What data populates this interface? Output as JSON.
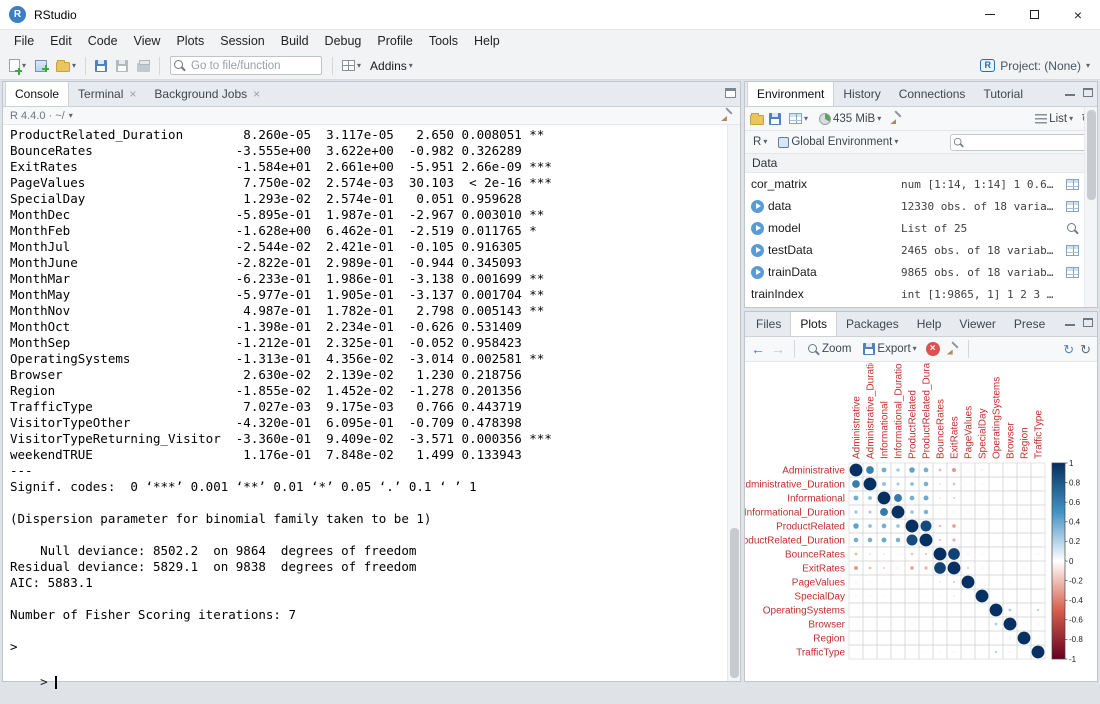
{
  "window": {
    "title": "RStudio",
    "logo_letter": "R"
  },
  "glyphs": {
    "caret": "▾",
    "close": "×",
    "back": "←",
    "forward": "→",
    "refresh": "↻",
    "prompt": "> "
  },
  "menu": {
    "items": [
      "File",
      "Edit",
      "Code",
      "View",
      "Plots",
      "Session",
      "Build",
      "Debug",
      "Profile",
      "Tools",
      "Help"
    ]
  },
  "toolbar": {
    "goto_placeholder": "Go to file/function",
    "addins_label": "Addins",
    "project_label": "Project: (None)",
    "project_icon_letter": "R"
  },
  "console_pane": {
    "tabs": [
      {
        "label": "Console",
        "active": true,
        "closable": false
      },
      {
        "label": "Terminal",
        "active": false,
        "closable": true
      },
      {
        "label": "Background Jobs",
        "active": false,
        "closable": true
      }
    ],
    "header": {
      "r_version": "R 4.4.0 · ~/"
    },
    "lines": [
      "ProductRelated_Duration        8.260e-05  3.117e-05   2.650 0.008051 **",
      "BounceRates                   -3.555e+00  3.622e+00  -0.982 0.326289",
      "ExitRates                     -1.584e+01  2.661e+00  -5.951 2.66e-09 ***",
      "PageValues                     7.750e-02  2.574e-03  30.103  < 2e-16 ***",
      "SpecialDay                     1.293e-02  2.574e-01   0.051 0.959628",
      "MonthDec                      -5.895e-01  1.987e-01  -2.967 0.003010 **",
      "MonthFeb                      -1.628e+00  6.462e-01  -2.519 0.011765 *",
      "MonthJul                      -2.544e-02  2.421e-01  -0.105 0.916305",
      "MonthJune                     -2.822e-01  2.989e-01  -0.944 0.345093",
      "MonthMar                      -6.233e-01  1.986e-01  -3.138 0.001699 **",
      "MonthMay                      -5.977e-01  1.905e-01  -3.137 0.001704 **",
      "MonthNov                       4.987e-01  1.782e-01   2.798 0.005143 **",
      "MonthOct                      -1.398e-01  2.234e-01  -0.626 0.531409",
      "MonthSep                      -1.212e-01  2.325e-01  -0.052 0.958423",
      "OperatingSystems              -1.313e-01  4.356e-02  -3.014 0.002581 **",
      "Browser                        2.630e-02  2.139e-02   1.230 0.218756",
      "Region                        -1.855e-02  1.452e-02  -1.278 0.201356",
      "TrafficType                    7.027e-03  9.175e-03   0.766 0.443719",
      "VisitorTypeOther              -4.320e-01  6.095e-01  -0.709 0.478398",
      "VisitorTypeReturning_Visitor  -3.360e-01  9.409e-02  -3.571 0.000356 ***",
      "weekendTRUE                    1.176e-01  7.848e-02   1.499 0.133943",
      "---",
      "Signif. codes:  0 ‘***’ 0.001 ‘**’ 0.01 ‘*’ 0.05 ‘.’ 0.1 ‘ ’ 1",
      "",
      "(Dispersion parameter for binomial family taken to be 1)",
      "",
      "    Null deviance: 8502.2  on 9864  degrees of freedom",
      "Residual deviance: 5829.1  on 9838  degrees of freedom",
      "AIC: 5883.1",
      "",
      "Number of Fisher Scoring iterations: 7",
      "",
      ">"
    ]
  },
  "environment_pane": {
    "tabs": [
      {
        "label": "Environment",
        "active": true
      },
      {
        "label": "History",
        "active": false
      },
      {
        "label": "Connections",
        "active": false
      },
      {
        "label": "Tutorial",
        "active": false
      }
    ],
    "toolbar": {
      "memory": "435 MiB",
      "view_mode": "List"
    },
    "scope": {
      "language": "R",
      "environment": "Global Environment"
    },
    "section": "Data",
    "objects": [
      {
        "name": "cor_matrix",
        "value": "num [1:14, 1:14] 1 0.6…",
        "expandable": false,
        "action": "grid"
      },
      {
        "name": "data",
        "value": "12330 obs. of 18 varia…",
        "expandable": true,
        "action": "grid"
      },
      {
        "name": "model",
        "value": "List of 25",
        "expandable": true,
        "action": "magnifier"
      },
      {
        "name": "testData",
        "value": "2465 obs. of 18 variab…",
        "expandable": true,
        "action": "grid"
      },
      {
        "name": "trainData",
        "value": "9865 obs. of 18 variab…",
        "expandable": true,
        "action": "grid"
      },
      {
        "name": "trainIndex",
        "value": "int [1:9865, 1] 1 2 3 …",
        "expandable": false,
        "action": "none"
      }
    ]
  },
  "plots_pane": {
    "tabs": [
      {
        "label": "Files",
        "active": false
      },
      {
        "label": "Plots",
        "active": true
      },
      {
        "label": "Packages",
        "active": false
      },
      {
        "label": "Help",
        "active": false
      },
      {
        "label": "Viewer",
        "active": false
      },
      {
        "label": "Prese",
        "active": false
      }
    ],
    "toolbar": {
      "zoom_label": "Zoom",
      "export_label": "Export"
    }
  },
  "chart_data": {
    "type": "heatmap",
    "subtype": "correlation-circles",
    "title": "",
    "variables": [
      "Administrative",
      "Administrative_Duration",
      "Informational",
      "Informational_Duration",
      "ProductRelated",
      "ProductRelated_Duration",
      "BounceRates",
      "ExitRates",
      "PageValues",
      "SpecialDay",
      "OperatingSystems",
      "Browser",
      "Region",
      "TrafficType"
    ],
    "diagonal": 1,
    "pairs": [
      [
        0,
        1,
        0.6
      ],
      [
        0,
        2,
        0.38
      ],
      [
        0,
        3,
        0.26
      ],
      [
        0,
        4,
        0.43
      ],
      [
        0,
        5,
        0.37
      ],
      [
        0,
        6,
        -0.22
      ],
      [
        0,
        7,
        -0.32
      ],
      [
        0,
        8,
        0.1
      ],
      [
        0,
        9,
        -0.09
      ],
      [
        0,
        10,
        -0.01
      ],
      [
        0,
        11,
        -0.02
      ],
      [
        0,
        12,
        -0.01
      ],
      [
        0,
        13,
        -0.03
      ],
      [
        1,
        2,
        0.3
      ],
      [
        1,
        3,
        0.24
      ],
      [
        1,
        4,
        0.29
      ],
      [
        1,
        5,
        0.36
      ],
      [
        1,
        6,
        -0.14
      ],
      [
        1,
        7,
        -0.21
      ],
      [
        1,
        8,
        0.07
      ],
      [
        1,
        9,
        -0.07
      ],
      [
        1,
        10,
        -0.01
      ],
      [
        1,
        11,
        -0.01
      ],
      [
        1,
        12,
        -0.01
      ],
      [
        1,
        13,
        -0.01
      ],
      [
        2,
        3,
        0.62
      ],
      [
        2,
        4,
        0.37
      ],
      [
        2,
        5,
        0.39
      ],
      [
        2,
        6,
        -0.12
      ],
      [
        2,
        7,
        -0.16
      ],
      [
        2,
        8,
        0.05
      ],
      [
        2,
        9,
        -0.05
      ],
      [
        2,
        10,
        -0.01
      ],
      [
        2,
        11,
        -0.01
      ],
      [
        2,
        12,
        -0.03
      ],
      [
        2,
        13,
        -0.03
      ],
      [
        3,
        4,
        0.28
      ],
      [
        3,
        5,
        0.35
      ],
      [
        3,
        6,
        -0.07
      ],
      [
        3,
        7,
        -0.11
      ],
      [
        3,
        8,
        0.03
      ],
      [
        3,
        9,
        -0.03
      ],
      [
        3,
        10,
        -0.01
      ],
      [
        3,
        11,
        -0.01
      ],
      [
        3,
        12,
        -0.02
      ],
      [
        3,
        13,
        -0.02
      ],
      [
        4,
        5,
        0.86
      ],
      [
        4,
        6,
        -0.2
      ],
      [
        4,
        7,
        -0.29
      ],
      [
        4,
        8,
        0.06
      ],
      [
        4,
        9,
        -0.02
      ],
      [
        4,
        10,
        -0.01
      ],
      [
        4,
        11,
        -0.01
      ],
      [
        4,
        12,
        -0.01
      ],
      [
        4,
        13,
        -0.04
      ],
      [
        5,
        6,
        -0.18
      ],
      [
        5,
        7,
        -0.25
      ],
      [
        5,
        8,
        0.05
      ],
      [
        5,
        9,
        -0.04
      ],
      [
        5,
        10,
        -0.01
      ],
      [
        5,
        11,
        -0.01
      ],
      [
        5,
        12,
        -0.01
      ],
      [
        5,
        13,
        -0.04
      ],
      [
        6,
        7,
        0.91
      ],
      [
        6,
        8,
        -0.12
      ],
      [
        6,
        9,
        0.07
      ],
      [
        6,
        10,
        0.02
      ],
      [
        6,
        11,
        -0.02
      ],
      [
        6,
        12,
        -0.01
      ],
      [
        6,
        13,
        0.08
      ],
      [
        7,
        8,
        -0.17
      ],
      [
        7,
        9,
        0.1
      ],
      [
        7,
        10,
        0.01
      ],
      [
        7,
        11,
        -0.01
      ],
      [
        7,
        12,
        0
      ],
      [
        7,
        13,
        0.08
      ],
      [
        8,
        9,
        -0.06
      ],
      [
        8,
        10,
        0.02
      ],
      [
        8,
        11,
        0.05
      ],
      [
        8,
        12,
        0.01
      ],
      [
        8,
        13,
        0.01
      ],
      [
        9,
        10,
        0
      ],
      [
        9,
        11,
        0
      ],
      [
        9,
        12,
        -0.02
      ],
      [
        9,
        13,
        -0.02
      ],
      [
        10,
        11,
        0.22
      ],
      [
        10,
        12,
        0.08
      ],
      [
        10,
        13,
        0.19
      ],
      [
        11,
        12,
        0.1
      ],
      [
        11,
        13,
        0.11
      ],
      [
        12,
        13,
        0.05
      ]
    ],
    "colorbar": {
      "min": -1,
      "max": 1,
      "ticks": [
        1,
        0.8,
        0.6,
        0.4,
        0.2,
        0,
        -0.2,
        -0.4,
        -0.6,
        -0.8,
        -1
      ],
      "positive_color": "#053061",
      "mid_pos": "#4393c3",
      "negative_color": "#67001f",
      "mid_neg": "#d6604d"
    },
    "label_color": "#c22f2f",
    "legend_position": "right",
    "grid": true
  }
}
